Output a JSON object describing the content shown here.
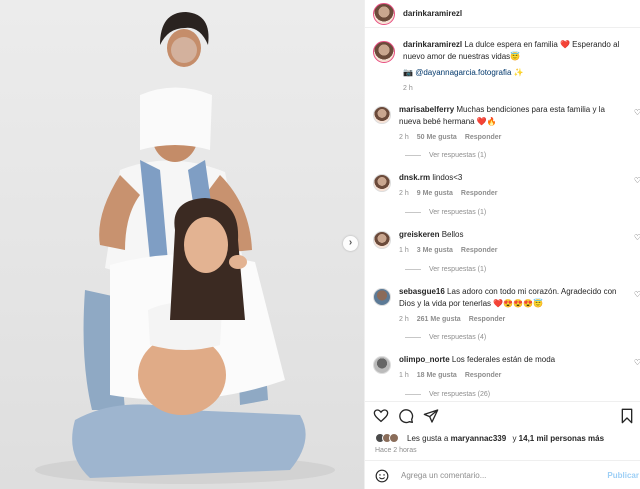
{
  "post": {
    "author": "darinkaramirezl",
    "caption_text": "La dulce espera en familia ❤️ Esperando al nuevo amor de nuestras vidas😇",
    "credit_prefix": "📷",
    "credit_handle": "@dayannagarcia.fotografia",
    "credit_suffix": "✨",
    "caption_time": "2 h"
  },
  "comments": [
    {
      "user": "marisabelferry",
      "text": "Muchas bendiciones para esta familia y la nueva bebé hermana ❤️🔥",
      "time": "2 h",
      "likes": "50 Me gusta",
      "reply": "Responder",
      "view_replies": "Ver respuestas (1)"
    },
    {
      "user": "dnsk.rm",
      "text": "lindos<3",
      "time": "2 h",
      "likes": "9 Me gusta",
      "reply": "Responder",
      "view_replies": "Ver respuestas (1)"
    },
    {
      "user": "greiskeren",
      "text": "Bellos",
      "time": "1 h",
      "likes": "3 Me gusta",
      "reply": "Responder",
      "view_replies": "Ver respuestas (1)"
    },
    {
      "user": "sebasgue16",
      "text": "Las adoro con todo mi corazón. Agradecido con Dios y la vida por tenerlas ❤️😍😍😍😇",
      "time": "2 h",
      "likes": "261 Me gusta",
      "reply": "Responder",
      "view_replies": "Ver respuestas (4)"
    },
    {
      "user": "olimpo_norte",
      "text": "Los federales están de moda",
      "time": "1 h",
      "likes": "18 Me gusta",
      "reply": "Responder",
      "view_replies": "Ver respuestas (26)"
    }
  ],
  "actions": {
    "icons": [
      "heart-icon",
      "comment-icon",
      "share-icon",
      "bookmark-icon"
    ],
    "likes_prefix": "Les gusta a",
    "likes_user": "maryannac339",
    "likes_mid": "y",
    "likes_count": "14,1 mil personas más",
    "posted_ago": "Hace 2 horas",
    "comment_placeholder": "Agrega un comentario...",
    "publish_label": "Publicar"
  },
  "colors": {
    "accent": "#0095f6",
    "link": "#00376b",
    "muted": "#8e8e8e",
    "like_red": "#ed4956"
  }
}
